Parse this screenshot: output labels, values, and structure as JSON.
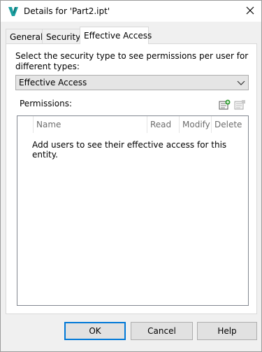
{
  "window": {
    "title": "Details for 'Part2.ipt'",
    "app_icon": "vault-logo-icon",
    "close_icon": "close-icon"
  },
  "tabs": [
    {
      "label": "General",
      "active": false
    },
    {
      "label": "Security",
      "active": false
    },
    {
      "label": "Effective Access",
      "active": true
    }
  ],
  "effective_access": {
    "instruction": "Select the security type to see permissions per user for different types:",
    "security_type": {
      "selected": "Effective Access",
      "arrow_icon": "chevron-down-icon"
    },
    "permissions_label": "Permissions:",
    "add_icon": "add-user-icon",
    "remove_icon": "remove-user-icon",
    "columns": [
      "Name",
      "Read",
      "Modify",
      "Delete"
    ],
    "rows": [],
    "empty_message": "Add users to see their effective access for this entity."
  },
  "buttons": {
    "ok": "OK",
    "cancel": "Cancel",
    "help": "Help"
  },
  "colors": {
    "accent": "#0078d7",
    "logo": "#1a9fa0"
  }
}
